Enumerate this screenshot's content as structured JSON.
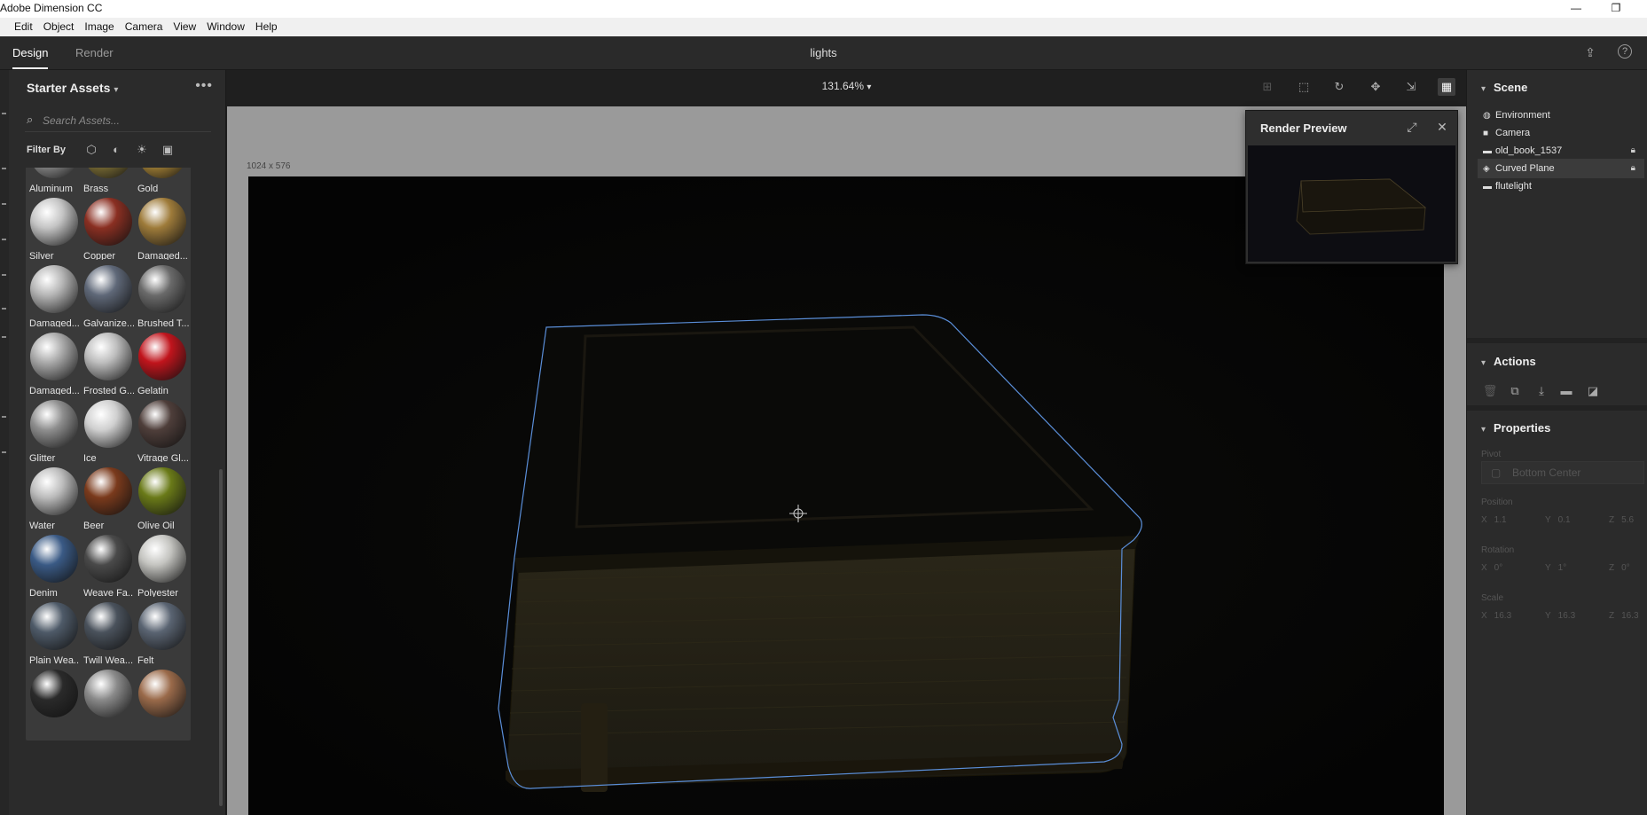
{
  "window": {
    "title": "Adobe Dimension CC",
    "minimize_icon": "minimize-icon",
    "restore_icon": "restore-icon"
  },
  "menu": [
    "Edit",
    "Object",
    "Image",
    "Camera",
    "View",
    "Window",
    "Help"
  ],
  "modes": {
    "design": "Design",
    "render": "Render"
  },
  "document": {
    "title": "lights"
  },
  "top_icons": [
    "share-icon",
    "help-icon"
  ],
  "assets": {
    "title": "Starter Assets",
    "search_placeholder": "Search Assets...",
    "filter_label": "Filter By",
    "filter_icons": [
      "model-filter-icon",
      "material-filter-icon",
      "light-filter-icon",
      "image-filter-icon"
    ],
    "items": [
      {
        "label": "Aluminum",
        "color": "#9a9a9a"
      },
      {
        "label": "Brass",
        "color": "#8a7a3a"
      },
      {
        "label": "Gold",
        "color": "#b8913b"
      },
      {
        "label": "Silver",
        "color": "#c4c4c4"
      },
      {
        "label": "Copper",
        "color": "#8a2f22"
      },
      {
        "label": "Damaged...",
        "color": "#9e7b3a"
      },
      {
        "label": "Damaged...",
        "color": "#b5b5b5"
      },
      {
        "label": "Galvanize...",
        "color": "#5f6878"
      },
      {
        "label": "Brushed T...",
        "color": "#6a6a6a"
      },
      {
        "label": "Damaged...",
        "color": "#a9a9a9"
      },
      {
        "label": "Frosted G...",
        "color": "#bdbdbd"
      },
      {
        "label": "Gelatin",
        "color": "#c0141c"
      },
      {
        "label": "Glitter",
        "color": "#8e8e8e"
      },
      {
        "label": "Ice",
        "color": "#cfcfcf"
      },
      {
        "label": "Vitrage Gl...",
        "color": "#4e3e3a"
      },
      {
        "label": "Water",
        "color": "#bcbcbc"
      },
      {
        "label": "Beer",
        "color": "#7a3a1c"
      },
      {
        "label": "Olive Oil",
        "color": "#6a7a18"
      },
      {
        "label": "Denim",
        "color": "#3a5a85"
      },
      {
        "label": "Weave Fa...",
        "color": "#4a4a4a"
      },
      {
        "label": "Polyester",
        "color": "#c4c4c0"
      },
      {
        "label": "Plain Wea...",
        "color": "#4e5a68"
      },
      {
        "label": "Twill Wea...",
        "color": "#4a525c"
      },
      {
        "label": "Felt",
        "color": "#5a6472"
      },
      {
        "label": "",
        "color": "#2a2a2a"
      },
      {
        "label": "",
        "color": "#8a8a8a"
      },
      {
        "label": "",
        "color": "#9a6a4a"
      }
    ]
  },
  "viewport": {
    "zoom": "131.64%",
    "canvas_size": "1024 x 576",
    "tools": [
      "fit-icon",
      "select-icon",
      "orbit-icon",
      "pan-icon",
      "dolly-icon",
      "magic-icon",
      "grid-toggle-icon"
    ]
  },
  "render_preview": {
    "title": "Render Preview"
  },
  "scene": {
    "title": "Scene",
    "items": [
      {
        "label": "Environment",
        "icon": "environment-icon",
        "locked": false
      },
      {
        "label": "Camera",
        "icon": "camera-icon",
        "locked": false
      },
      {
        "label": "old_book_1537",
        "icon": "folder-icon",
        "locked": true
      },
      {
        "label": "Curved Plane",
        "icon": "model-icon",
        "locked": true
      },
      {
        "label": "flutelight",
        "icon": "folder-icon",
        "locked": false
      }
    ]
  },
  "actions": {
    "title": "Actions",
    "icons": [
      "delete-icon",
      "duplicate-icon",
      "drop-icon",
      "group-icon",
      "save-icon"
    ]
  },
  "properties": {
    "title": "Properties",
    "pivot_label": "Pivot",
    "pivot_value": "Bottom Center",
    "position_label": "Position",
    "position": {
      "x": "1.1",
      "y": "0.1",
      "z": "5.6"
    },
    "rotation_label": "Rotation",
    "rotation": {
      "x": "0°",
      "y": "1°",
      "z": "0°"
    },
    "scale_label": "Scale",
    "scale": {
      "x": "16.3",
      "y": "16.3",
      "z": "16.3"
    }
  }
}
